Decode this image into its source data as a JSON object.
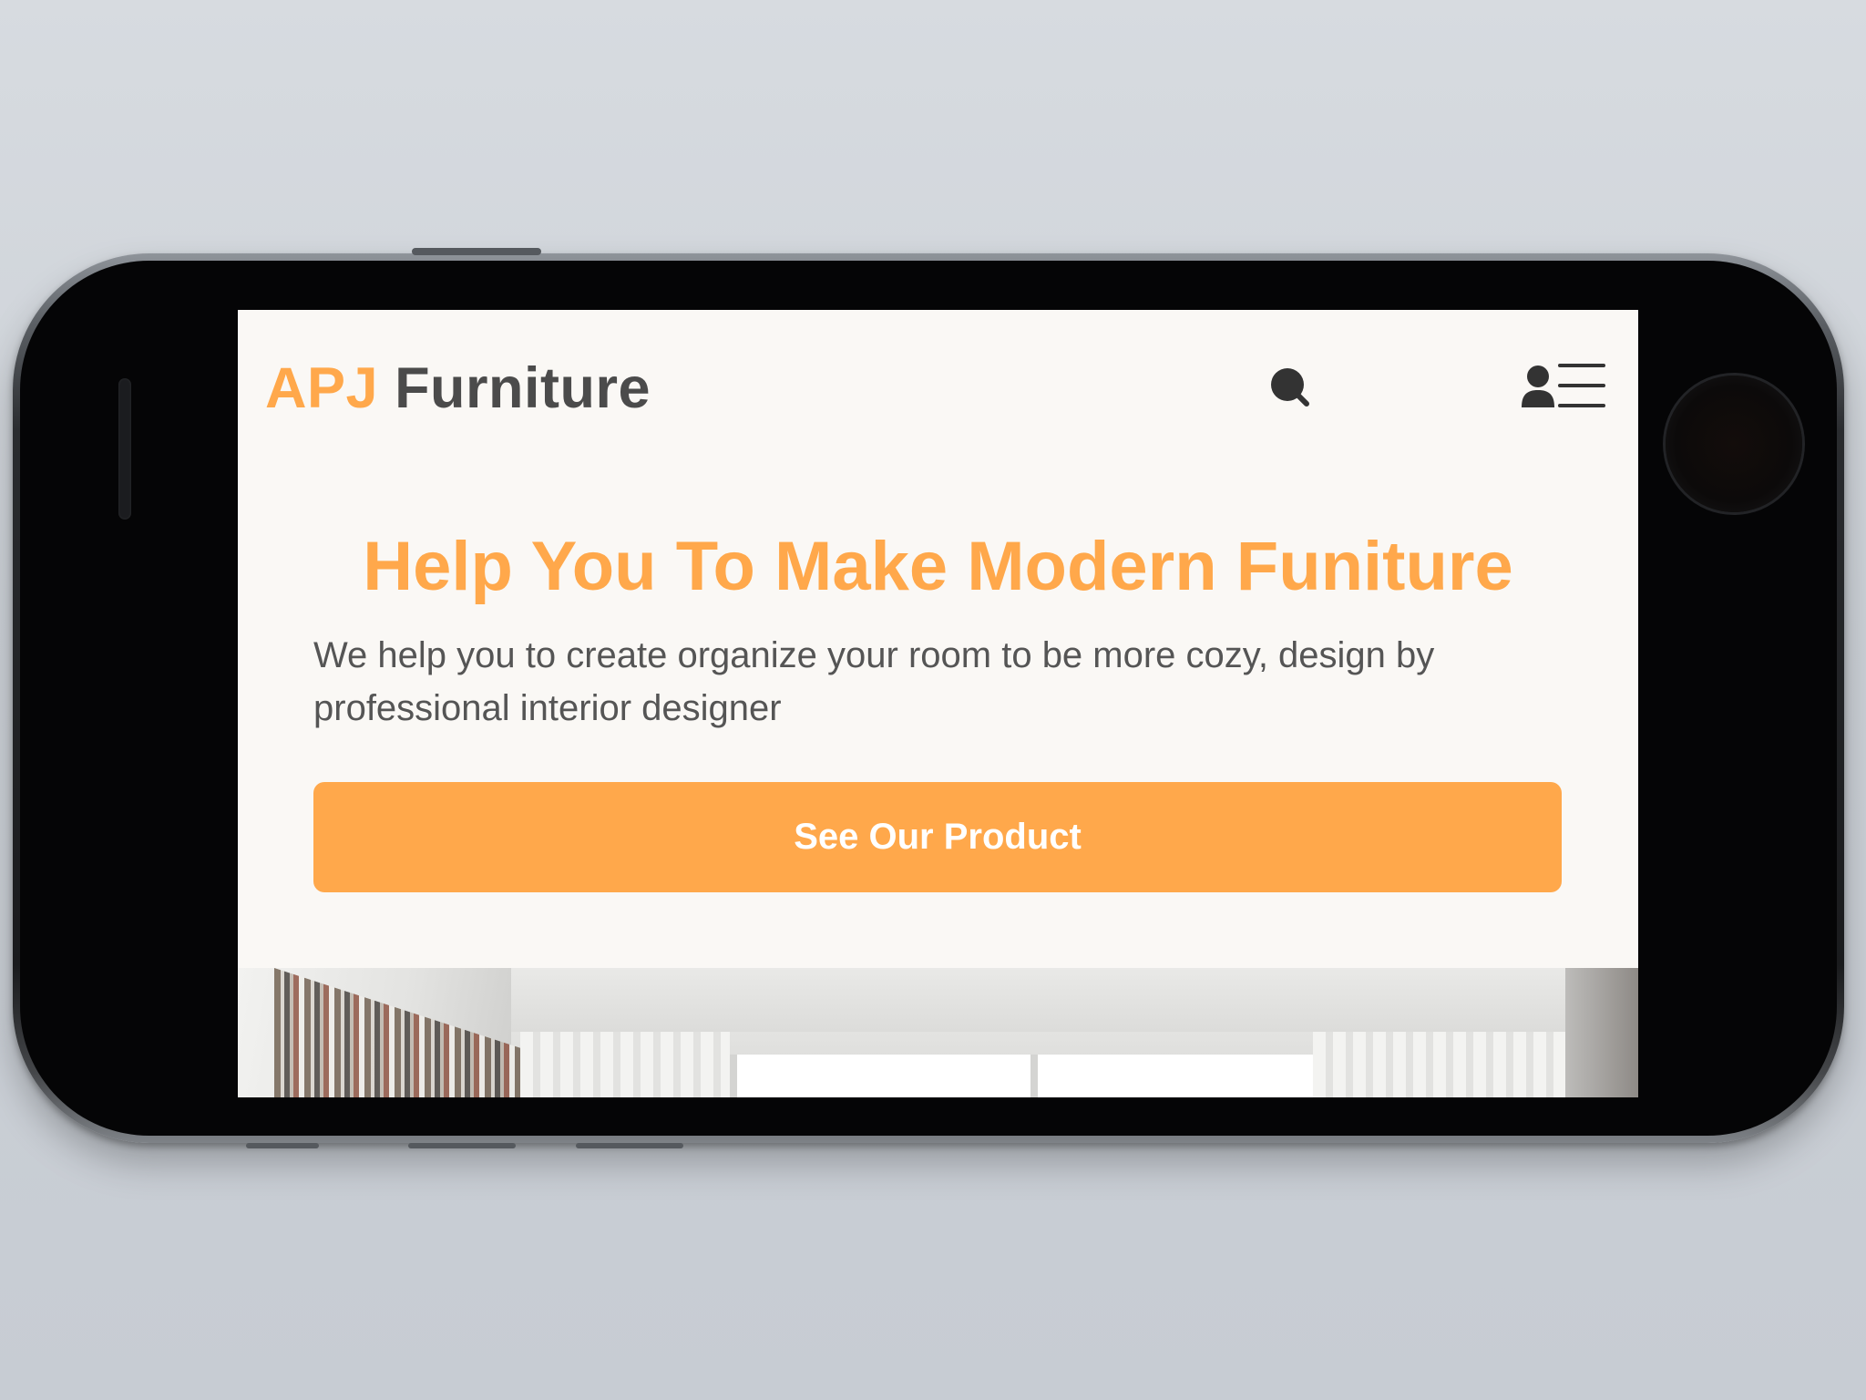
{
  "header": {
    "logo_accent": "APJ",
    "logo_rest": "Furniture",
    "icons": [
      "search-icon",
      "user-icon",
      "menu-icon"
    ]
  },
  "hero": {
    "title": "Help You To Make Modern Funiture",
    "subtitle": "We help you to create organize your room to be more cozy, design by professional interior designer",
    "cta_label": "See Our Product"
  },
  "colors": {
    "accent": "#ffa84b",
    "text_dark": "#4b4b4b",
    "text_body": "#555555",
    "screen_background": "#faf8f5"
  }
}
